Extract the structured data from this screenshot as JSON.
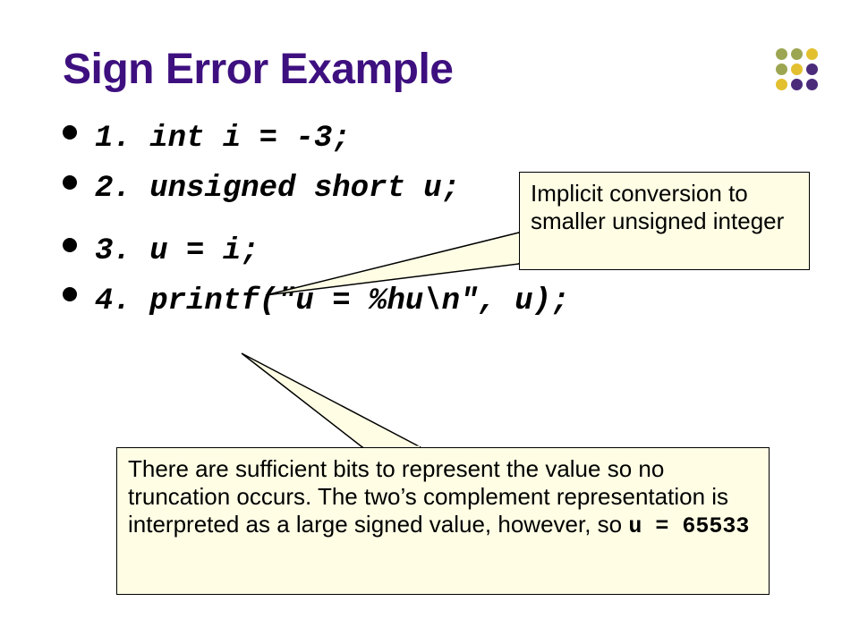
{
  "title": "Sign Error Example",
  "code": {
    "l1": "1. int i = -3;",
    "l2": "2. unsigned short u;",
    "l3": "3. u = i;",
    "l4": "4. printf(\"u = %hu\\n\", u);"
  },
  "callout1": "Implicit conversion to smaller unsigned integer",
  "callout2_text": "There are sufficient bits to represent the value so no truncation occurs.  The two’s complement representation is interpreted as a large signed value, however, so ",
  "callout2_code": "u = 65533",
  "dot_colors": {
    "olive": "#9CA652",
    "gold": "#E2C030",
    "purple": "#4A2C7B"
  }
}
